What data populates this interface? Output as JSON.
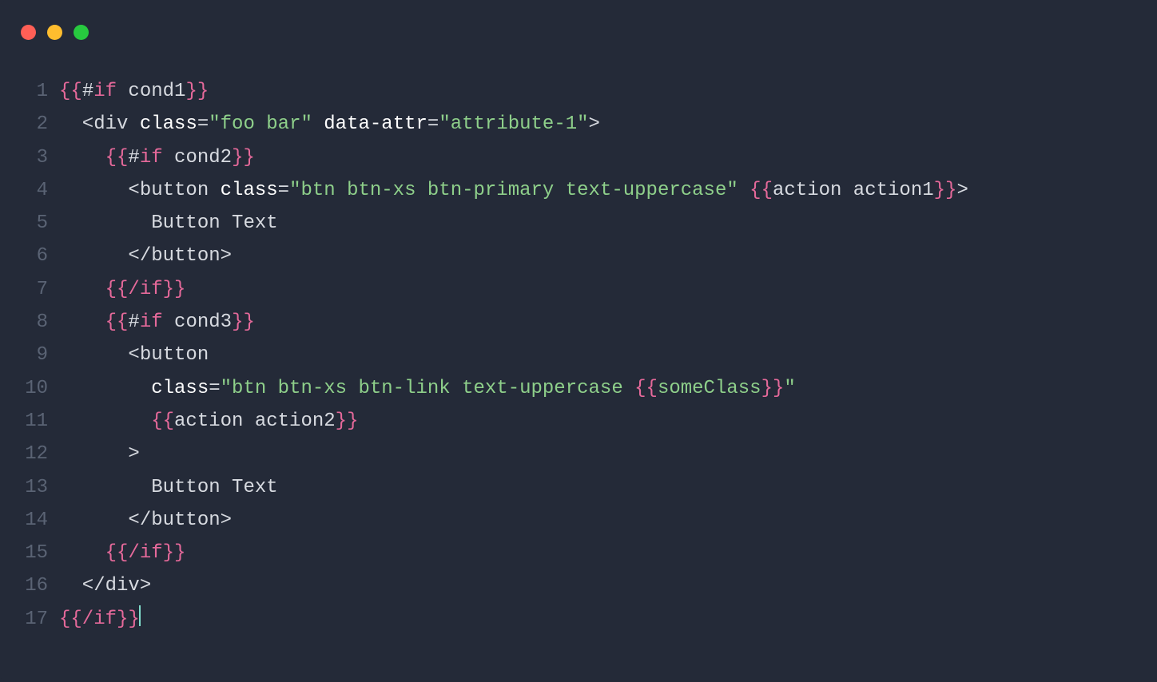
{
  "titlebar": {
    "dots": [
      "red",
      "yellow",
      "green"
    ]
  },
  "lines": [
    {
      "num": "1",
      "tokens": [
        {
          "cls": "tok-pink",
          "t": "{{"
        },
        {
          "cls": "tok-plain",
          "t": "#"
        },
        {
          "cls": "tok-pink",
          "t": "if"
        },
        {
          "cls": "tok-plain",
          "t": " cond1"
        },
        {
          "cls": "tok-pink",
          "t": "}}"
        }
      ]
    },
    {
      "num": "2",
      "tokens": [
        {
          "cls": "tok-plain",
          "t": "  <div "
        },
        {
          "cls": "tok-white",
          "t": "class"
        },
        {
          "cls": "tok-plain",
          "t": "="
        },
        {
          "cls": "tok-green",
          "t": "\"foo bar\""
        },
        {
          "cls": "tok-white",
          "t": " data-attr"
        },
        {
          "cls": "tok-plain",
          "t": "="
        },
        {
          "cls": "tok-green",
          "t": "\"attribute-1\""
        },
        {
          "cls": "tok-plain",
          "t": ">"
        }
      ]
    },
    {
      "num": "3",
      "tokens": [
        {
          "cls": "tok-plain",
          "t": "    "
        },
        {
          "cls": "tok-pink",
          "t": "{{"
        },
        {
          "cls": "tok-plain",
          "t": "#"
        },
        {
          "cls": "tok-pink",
          "t": "if"
        },
        {
          "cls": "tok-plain",
          "t": " cond2"
        },
        {
          "cls": "tok-pink",
          "t": "}}"
        }
      ]
    },
    {
      "num": "4",
      "tokens": [
        {
          "cls": "tok-plain",
          "t": "      <button "
        },
        {
          "cls": "tok-white",
          "t": "class"
        },
        {
          "cls": "tok-plain",
          "t": "="
        },
        {
          "cls": "tok-green",
          "t": "\"btn btn-xs btn-primary text-uppercase\""
        },
        {
          "cls": "tok-plain",
          "t": " "
        },
        {
          "cls": "tok-pink",
          "t": "{{"
        },
        {
          "cls": "tok-plain",
          "t": "action action1"
        },
        {
          "cls": "tok-pink",
          "t": "}}"
        },
        {
          "cls": "tok-plain",
          "t": ">"
        }
      ]
    },
    {
      "num": "5",
      "tokens": [
        {
          "cls": "tok-plain",
          "t": "        Button Text"
        }
      ]
    },
    {
      "num": "6",
      "tokens": [
        {
          "cls": "tok-plain",
          "t": "      </button>"
        }
      ]
    },
    {
      "num": "7",
      "tokens": [
        {
          "cls": "tok-plain",
          "t": "    "
        },
        {
          "cls": "tok-pink",
          "t": "{{/if}}"
        }
      ]
    },
    {
      "num": "8",
      "tokens": [
        {
          "cls": "tok-plain",
          "t": "    "
        },
        {
          "cls": "tok-pink",
          "t": "{{"
        },
        {
          "cls": "tok-plain",
          "t": "#"
        },
        {
          "cls": "tok-pink",
          "t": "if"
        },
        {
          "cls": "tok-plain",
          "t": " cond3"
        },
        {
          "cls": "tok-pink",
          "t": "}}"
        }
      ]
    },
    {
      "num": "9",
      "tokens": [
        {
          "cls": "tok-plain",
          "t": "      <button"
        }
      ]
    },
    {
      "num": "10",
      "tokens": [
        {
          "cls": "tok-plain",
          "t": "        "
        },
        {
          "cls": "tok-white",
          "t": "class"
        },
        {
          "cls": "tok-plain",
          "t": "="
        },
        {
          "cls": "tok-green",
          "t": "\"btn btn-xs btn-link text-uppercase "
        },
        {
          "cls": "tok-pink",
          "t": "{{"
        },
        {
          "cls": "tok-green",
          "t": "someClass"
        },
        {
          "cls": "tok-pink",
          "t": "}}"
        },
        {
          "cls": "tok-green",
          "t": "\""
        }
      ]
    },
    {
      "num": "11",
      "tokens": [
        {
          "cls": "tok-plain",
          "t": "        "
        },
        {
          "cls": "tok-pink",
          "t": "{{"
        },
        {
          "cls": "tok-plain",
          "t": "action action2"
        },
        {
          "cls": "tok-pink",
          "t": "}}"
        }
      ]
    },
    {
      "num": "12",
      "tokens": [
        {
          "cls": "tok-plain",
          "t": "      >"
        }
      ]
    },
    {
      "num": "13",
      "tokens": [
        {
          "cls": "tok-plain",
          "t": "        Button Text"
        }
      ]
    },
    {
      "num": "14",
      "tokens": [
        {
          "cls": "tok-plain",
          "t": "      </button>"
        }
      ]
    },
    {
      "num": "15",
      "tokens": [
        {
          "cls": "tok-plain",
          "t": "    "
        },
        {
          "cls": "tok-pink",
          "t": "{{/if}}"
        }
      ]
    },
    {
      "num": "16",
      "tokens": [
        {
          "cls": "tok-plain",
          "t": "  </div>"
        }
      ]
    },
    {
      "num": "17",
      "tokens": [
        {
          "cls": "tok-pink",
          "t": "{{/if}}"
        }
      ],
      "cursor": true
    }
  ]
}
